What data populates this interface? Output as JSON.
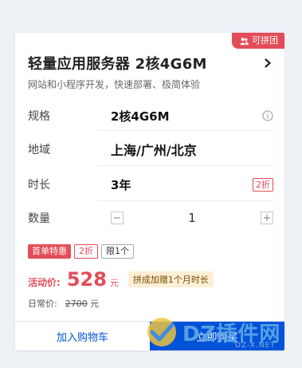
{
  "badge": {
    "label": "可拼团"
  },
  "product": {
    "title": "轻量应用服务器 2核4G6M",
    "subtitle": "网站和小程序开发，快速部署、极简体验"
  },
  "spec": {
    "label": "规格",
    "value": "2核4G6M"
  },
  "region": {
    "label": "地域",
    "value": "上海/广州/北京"
  },
  "duration": {
    "label": "时长",
    "value": "3年",
    "discount": "2折"
  },
  "quantity": {
    "label": "数量",
    "value": "1",
    "minus": "−",
    "plus": "+"
  },
  "tags": {
    "first_order": "首单特惠",
    "discount": "2折",
    "limit": "限1个"
  },
  "price": {
    "label": "活动价:",
    "value": "528",
    "unit": "元",
    "promo": "拼成加赠1个月时长"
  },
  "original": {
    "label": "日常价:",
    "value": "2700",
    "unit": "元"
  },
  "actions": {
    "cart": "加入购物车",
    "buy": "立即购买"
  },
  "watermark": {
    "text": "DZ插件网",
    "sub": "DZ-X.NET"
  },
  "colors": {
    "accent": "#e34d59",
    "primary": "#0052d9",
    "promo_bg": "#fdefd5"
  },
  "icons": {
    "badge": "group-icon",
    "title": "chevron-right-icon",
    "spec": "info-icon"
  }
}
